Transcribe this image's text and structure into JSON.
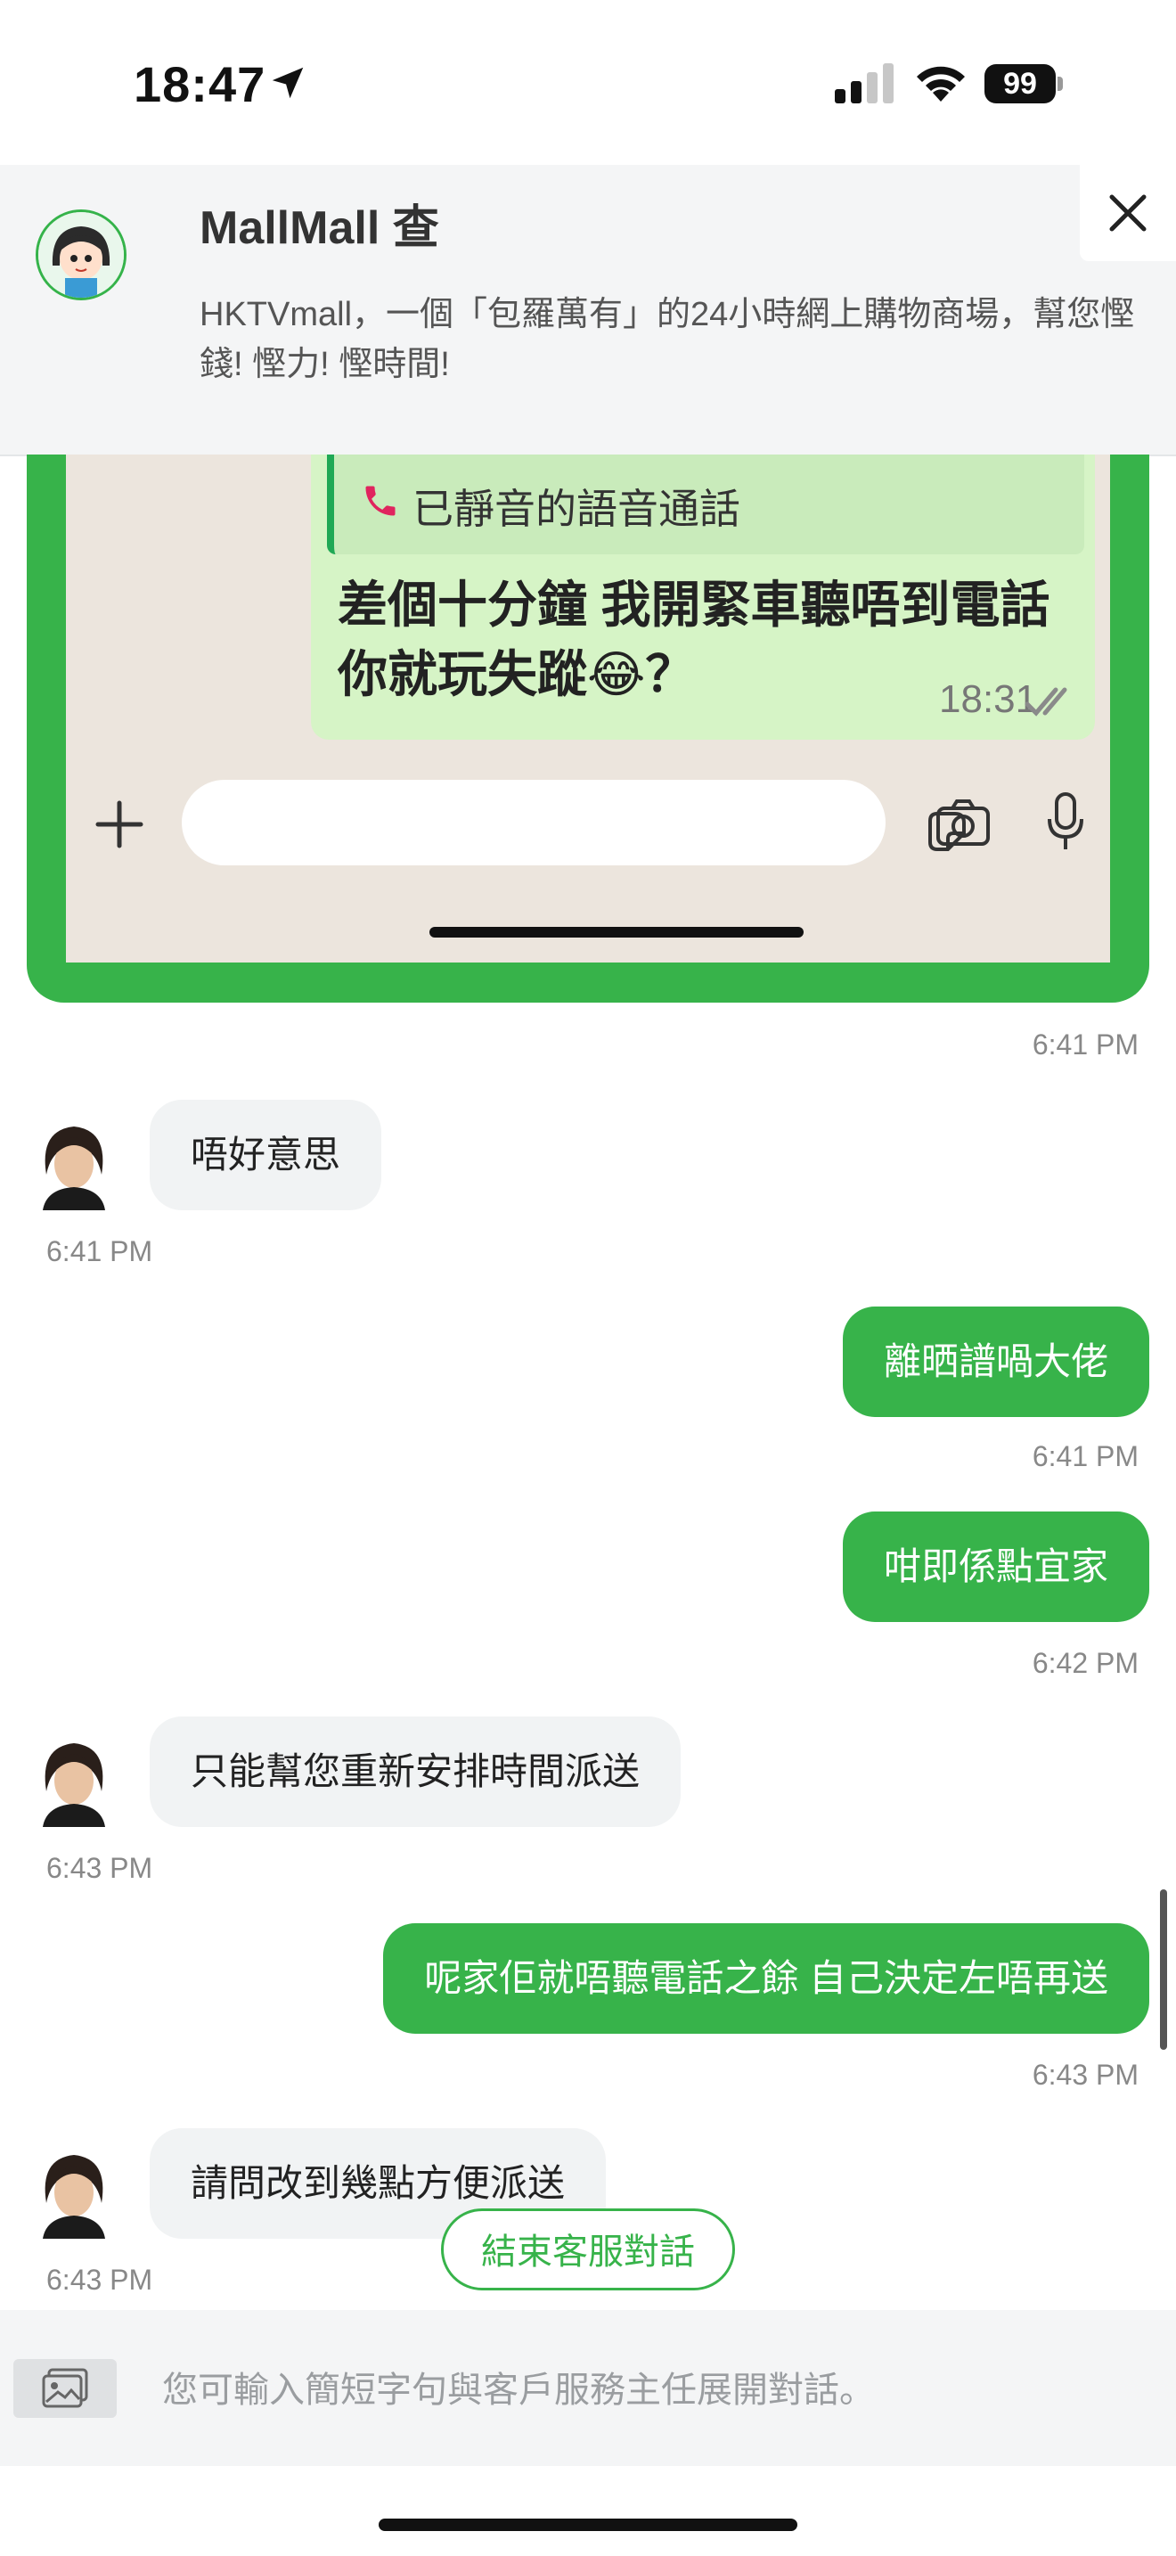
{
  "status_bar": {
    "time": "18:47",
    "battery": "99",
    "icons": [
      "location-arrow-icon",
      "signal-icon",
      "wifi-icon",
      "battery-icon"
    ]
  },
  "header": {
    "title": "MallMall 查",
    "description": "HKTVmall，一個「包羅萬有」的24小時網上購物商場，幫您慳錢! 慳力! 慳時間!",
    "close_icon": "close-icon"
  },
  "quoted_screenshot": {
    "call_label": "已靜音的語音通話",
    "message": "差個十分鐘 我開緊車聽唔到電話 你就玩失蹤😂？",
    "time": "18:31"
  },
  "messages": [
    {
      "kind": "timestamp",
      "side": "right",
      "time": "6:41 PM"
    },
    {
      "kind": "in",
      "text": "唔好意思",
      "time": "6:41 PM"
    },
    {
      "kind": "out",
      "text": "離晒譜喎大佬",
      "time": "6:41 PM"
    },
    {
      "kind": "out",
      "text": "咁即係點宜家",
      "time": "6:42 PM"
    },
    {
      "kind": "in",
      "text": "只能幫您重新安排時間派送",
      "time": "6:43 PM"
    },
    {
      "kind": "out",
      "text": "呢家佢就唔聽電話之餘 自己決定左唔再送",
      "time": "6:43 PM"
    },
    {
      "kind": "in",
      "text": "請問改到幾點方便派送",
      "time": "6:43 PM"
    }
  ],
  "end_chat_button": "結束客服對話",
  "input": {
    "placeholder": "您可輸入簡短字句與客戶服務主任展開對話。"
  },
  "colors": {
    "accent_green": "#37b34a",
    "incoming_bubble": "#f1f3f4",
    "header_bg": "#f4f5f6"
  }
}
